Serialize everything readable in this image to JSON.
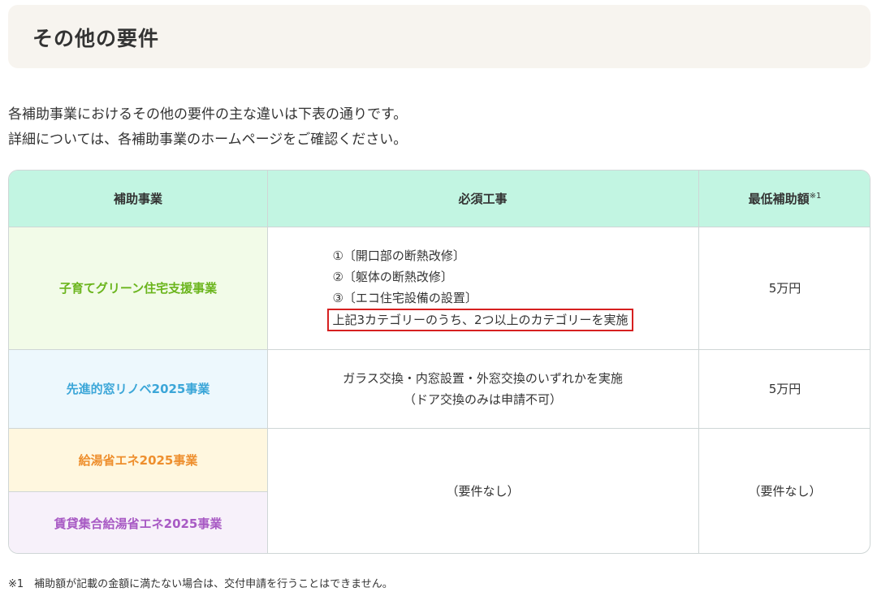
{
  "section": {
    "title": "その他の要件",
    "intro_line1": "各補助事業におけるその他の要件の主な違いは下表の通りです。",
    "intro_line2": "詳細については、各補助事業のホームページをご確認ください。"
  },
  "table": {
    "headers": {
      "program": "補助事業",
      "required_work": "必須工事",
      "min_amount": "最低補助額",
      "min_amount_note": "※1"
    },
    "rows": [
      {
        "program": "子育てグリーン住宅支援事業",
        "program_color": "#6bb51d",
        "program_bg": "#f2fbe8",
        "req_items": [
          "①〔開口部の断熱改修〕",
          "②〔躯体の断熱改修〕",
          "③〔エコ住宅設備の設置〕"
        ],
        "req_highlight": "上記3カテゴリーのうち、2つ以上のカテゴリーを実施",
        "amount": "5万円"
      },
      {
        "program": "先進的窓リノベ2025事業",
        "program_color": "#3ba6d8",
        "program_bg": "#edf8fd",
        "req_line1": "ガラス交換・内窓設置・外窓交換のいずれかを実施",
        "req_line2": "（ドア交換のみは申請不可）",
        "amount": "5万円"
      },
      {
        "program": "給湯省エネ2025事業",
        "program_color": "#ee8f2e",
        "program_bg": "#fff7df"
      },
      {
        "program": "賃貸集合給湯省エネ2025事業",
        "program_color": "#a85ac4",
        "program_bg": "#f7f1fa"
      }
    ],
    "merged_required": "（要件なし）",
    "merged_amount": "（要件なし）"
  },
  "footnote": "※1　補助額が記載の金額に満たない場合は、交付申請を行うことはできません。",
  "colors": {
    "header_bg": "#c2f5e2",
    "highlight_border": "#d62020",
    "heading_bg": "#f7f4ef"
  }
}
